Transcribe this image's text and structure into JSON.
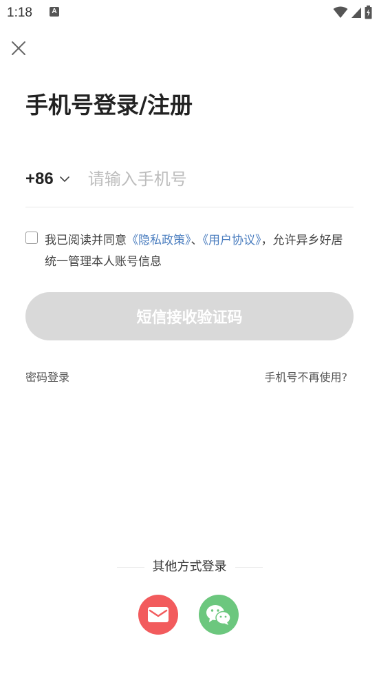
{
  "status_bar": {
    "time": "1:18",
    "notification_letter": "A"
  },
  "title": "手机号登录/注册",
  "phone": {
    "country_code": "+86",
    "placeholder": "请输入手机号",
    "value": ""
  },
  "agreement": {
    "prefix": "我已阅读并同意",
    "privacy_link": "《隐私政策》",
    "separator": "、",
    "user_link": "《用户协议》",
    "suffix": "，允许异乡好居统一管理本人账号信息",
    "checked": false
  },
  "sms_button_label": "短信接收验证码",
  "links": {
    "password_login": "密码登录",
    "phone_unused": "手机号不再使用?"
  },
  "other_login": {
    "label": "其他方式登录",
    "methods": [
      "email-icon",
      "wechat-icon"
    ]
  },
  "colors": {
    "link": "#4a7dbf",
    "button_disabled": "#d9d9d9",
    "email": "#f25b5d",
    "wechat": "#6cc77e"
  }
}
